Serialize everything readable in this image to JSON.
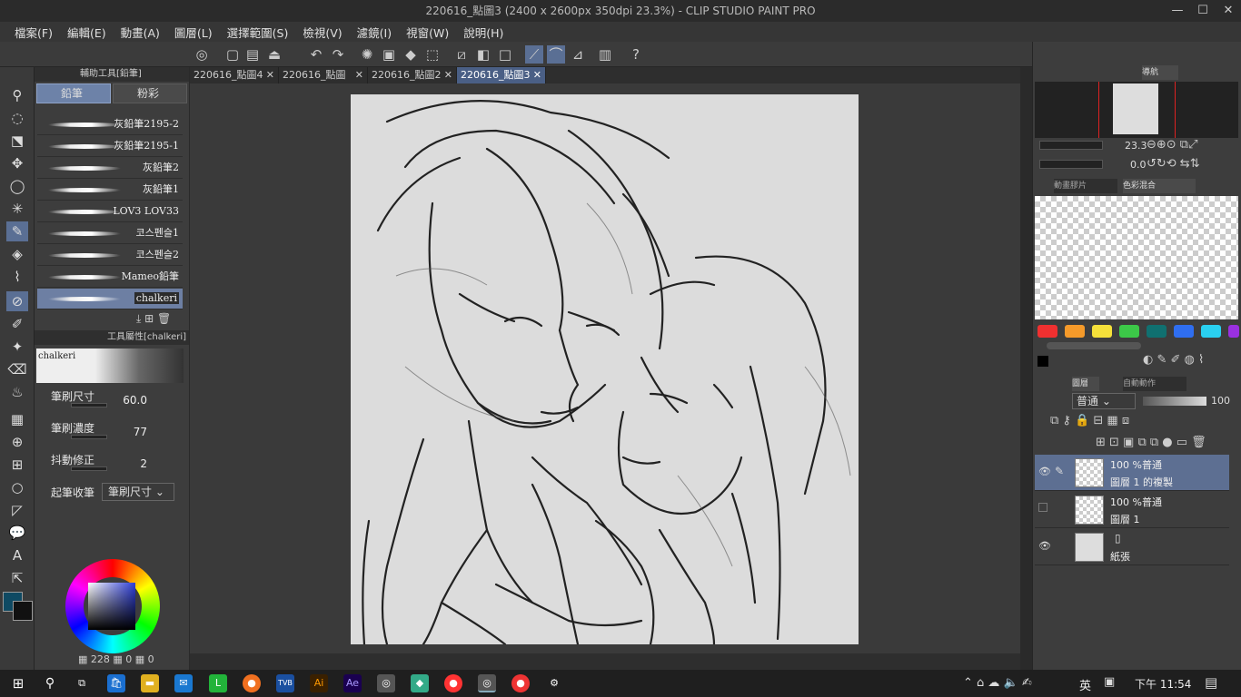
{
  "window": {
    "title": "220616_點圖3 (2400 x 2600px 350dpi 23.3%)  - CLIP STUDIO PAINT PRO",
    "minimize": "—",
    "maximize": "☐",
    "close": "✕"
  },
  "menu": [
    "檔案(F)",
    "編輯(E)",
    "動畫(A)",
    "圖層(L)",
    "選擇範圍(S)",
    "檢視(V)",
    "濾鏡(I)",
    "視窗(W)",
    "說明(H)"
  ],
  "subtool": {
    "header": "輔助工具[鉛筆]",
    "tabs": [
      "鉛筆",
      "粉彩"
    ],
    "brushes": [
      "灰鉛筆2195-2",
      "灰鉛筆2195-1",
      "灰鉛筆2",
      "灰鉛筆1",
      "LOV3 LOV33",
      "코스펜슬1",
      "코스펜슬2",
      "Mameo鉛筆",
      "chalkeri"
    ]
  },
  "toolprop": {
    "header": "工具屬性[chalkeri]",
    "preview_name": "chalkeri",
    "rows": [
      {
        "label": "筆刷尺寸",
        "value": "60.0"
      },
      {
        "label": "筆刷濃度",
        "value": "77"
      },
      {
        "label": "抖動修正",
        "value": "2"
      },
      {
        "label": "起筆收筆",
        "value": "筆刷尺寸"
      }
    ]
  },
  "color": {
    "main": "#0f4a63",
    "sub": "#111111",
    "readout_a": "228",
    "readout_b": "0",
    "readout_c": "0"
  },
  "tabs": [
    {
      "label": "220616_點圖4",
      "selected": false
    },
    {
      "label": "220616_點圖",
      "selected": false
    },
    {
      "label": "220616_點圖2",
      "selected": false
    },
    {
      "label": "220616_點圖3",
      "selected": true
    }
  ],
  "navigator": {
    "tab": "導航",
    "zoom": "23.3",
    "rotation": "0.0"
  },
  "colormix": {
    "tab1": "動畫膠片",
    "tab2": "色彩混合"
  },
  "palette": [
    "#f03030",
    "#f59a2a",
    "#f5e03a",
    "#3cc848",
    "#107070",
    "#2f6ef0",
    "#2ad0f0",
    "#9a30e0"
  ],
  "layers": {
    "tab1": "圖層",
    "tab2": "自動動作",
    "blend_mode": "普通",
    "opacity": "100",
    "items": [
      {
        "line1": "100 %普通",
        "line2": "圖層 1 的複製",
        "visible": true,
        "selected": true
      },
      {
        "line1": "100 %普通",
        "line2": "圖層 1",
        "visible": false,
        "selected": false
      },
      {
        "line1": "",
        "line2": "紙張",
        "visible": true,
        "selected": false
      }
    ]
  },
  "taskbar": {
    "ime": "英",
    "time": "下午 11:54"
  }
}
